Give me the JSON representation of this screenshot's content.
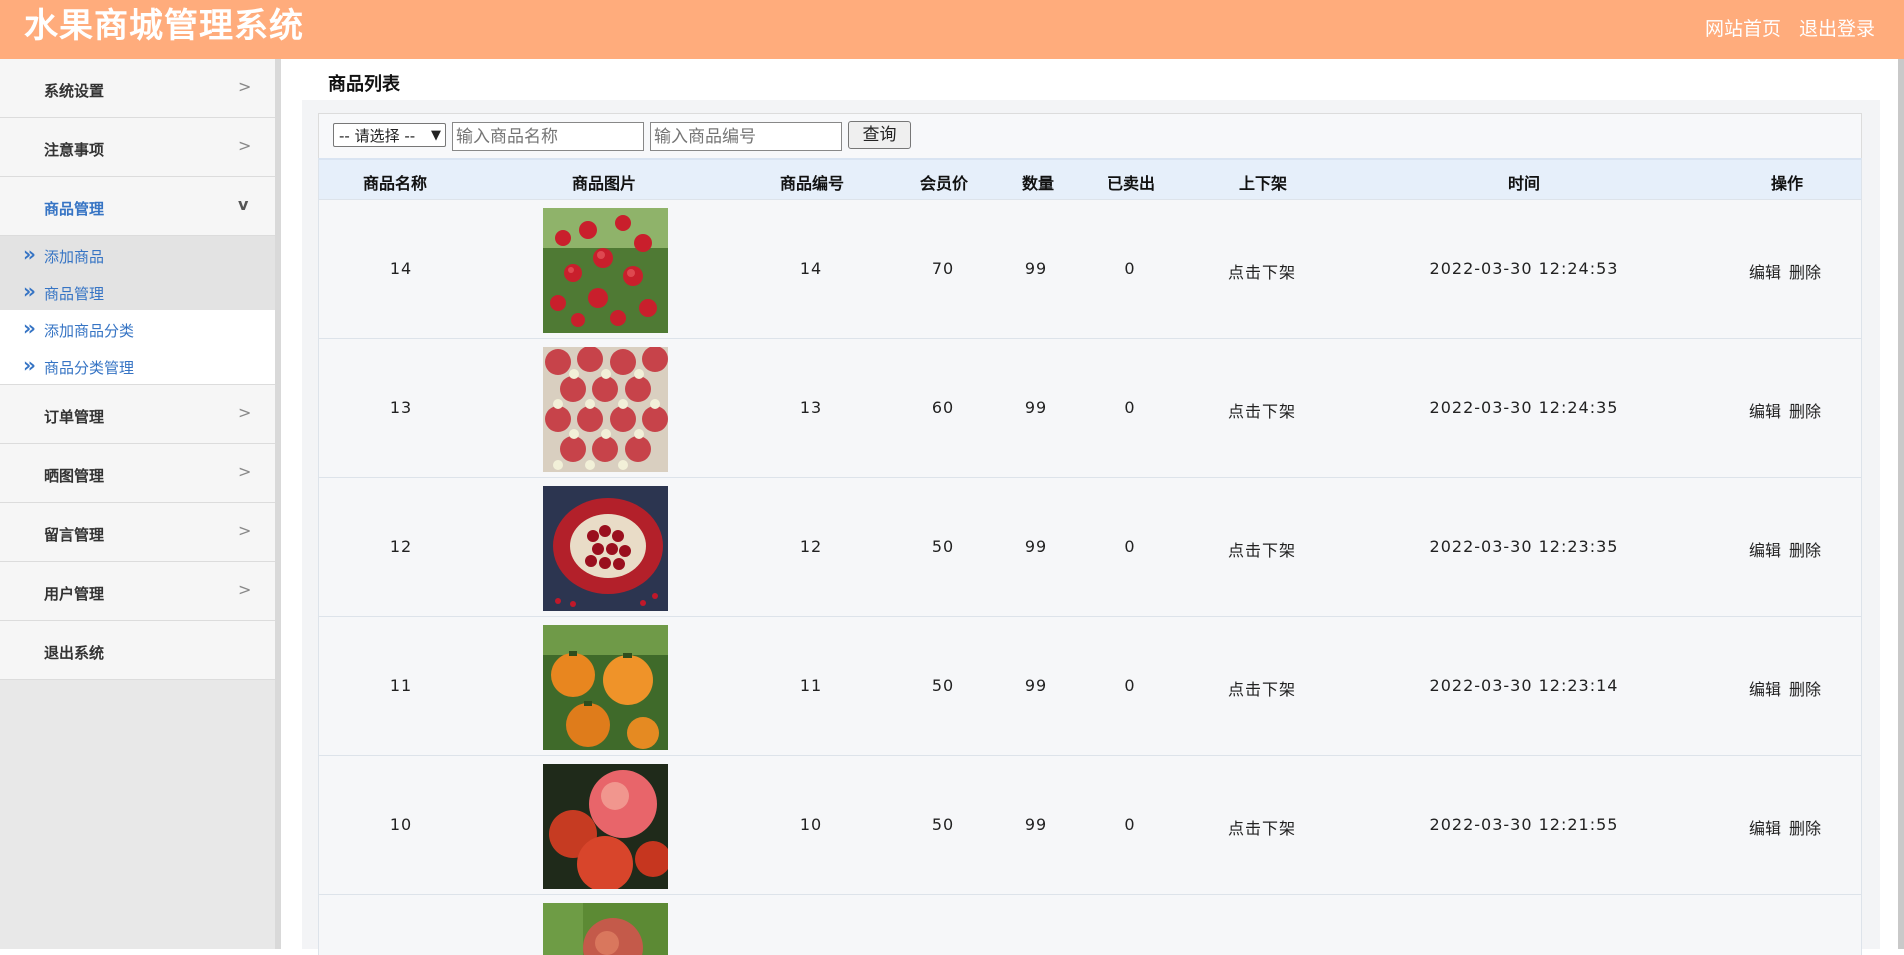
{
  "header": {
    "title": "水果商城管理系统",
    "home_link": "网站首页",
    "logout_link": "退出登录"
  },
  "sidebar": {
    "items": [
      {
        "label": "系统设置",
        "arrow": ">"
      },
      {
        "label": "注意事项",
        "arrow": ">"
      },
      {
        "label": "商品管理",
        "arrow": "v"
      },
      {
        "label": "订单管理",
        "arrow": ">"
      },
      {
        "label": "晒图管理",
        "arrow": ">"
      },
      {
        "label": "留言管理",
        "arrow": ">"
      },
      {
        "label": "用户管理",
        "arrow": ">"
      },
      {
        "label": "退出系统"
      }
    ],
    "subitems": [
      {
        "label": "添加商品"
      },
      {
        "label": "商品管理"
      },
      {
        "label": "添加商品分类"
      },
      {
        "label": "商品分类管理"
      }
    ],
    "chevron": "»"
  },
  "main": {
    "title": "商品列表",
    "filter": {
      "select_value": "-- 请选择 --",
      "name_placeholder": "输入商品名称",
      "code_placeholder": "输入商品编号",
      "query_label": "查询"
    },
    "columns": [
      "商品名称",
      "商品图片",
      "商品编号",
      "会员价",
      "数量",
      "已卖出",
      "上下架",
      "时间",
      "操作"
    ],
    "rows": [
      {
        "name": "14",
        "code": "14",
        "price": "70",
        "qty": "99",
        "sold": "0",
        "toggle": "点击下架",
        "time": "2022-03-30 12:24:53",
        "edit": "编辑",
        "del": "删除",
        "image": "lychee"
      },
      {
        "name": "13",
        "code": "13",
        "price": "60",
        "qty": "99",
        "sold": "0",
        "toggle": "点击下架",
        "time": "2022-03-30 12:24:35",
        "edit": "编辑",
        "del": "删除",
        "image": "rambutan"
      },
      {
        "name": "12",
        "code": "12",
        "price": "50",
        "qty": "99",
        "sold": "0",
        "toggle": "点击下架",
        "time": "2022-03-30 12:23:35",
        "edit": "编辑",
        "del": "删除",
        "image": "pomegranate"
      },
      {
        "name": "11",
        "code": "11",
        "price": "50",
        "qty": "99",
        "sold": "0",
        "toggle": "点击下架",
        "time": "2022-03-30 12:23:14",
        "edit": "编辑",
        "del": "删除",
        "image": "persimmon"
      },
      {
        "name": "10",
        "code": "10",
        "price": "50",
        "qty": "99",
        "sold": "0",
        "toggle": "点击下架",
        "time": "2022-03-30 12:21:55",
        "edit": "编辑",
        "del": "删除",
        "image": "apple"
      }
    ],
    "partial_row_image": "pear"
  },
  "colors": {
    "header_bg": "#ffac7c",
    "accent": "#3674c4",
    "table_head_bg": "#e6effa"
  }
}
